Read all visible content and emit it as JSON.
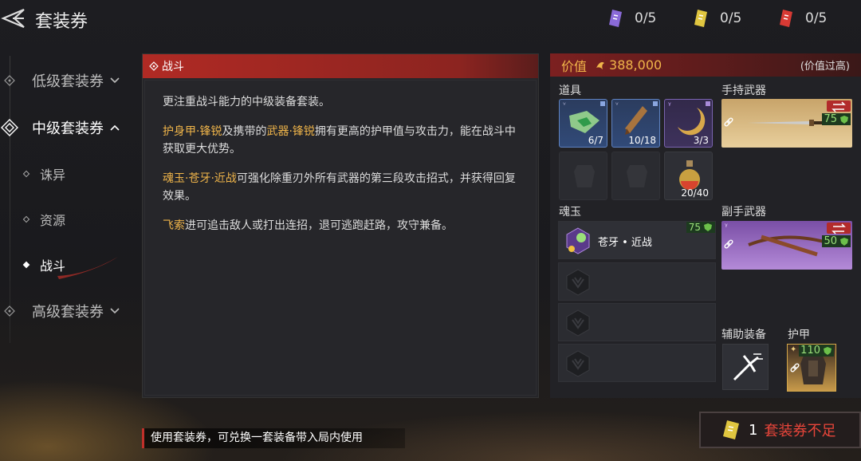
{
  "header": {
    "title": "套装券"
  },
  "currencies": [
    {
      "value": "0/5",
      "color": "#8a6ad8",
      "icon": "ticket-purple-icon"
    },
    {
      "value": "0/5",
      "color": "#e0c640",
      "icon": "ticket-gold-icon"
    },
    {
      "value": "0/5",
      "color": "#d83a34",
      "icon": "ticket-red-icon"
    }
  ],
  "sidebar": {
    "groups": [
      {
        "label": "低级套装券"
      },
      {
        "label": "中级套装券"
      },
      {
        "label": "高级套装券"
      }
    ],
    "subitems": [
      {
        "label": "诛异"
      },
      {
        "label": "资源"
      },
      {
        "label": "战斗"
      }
    ]
  },
  "panel": {
    "title": "战斗",
    "intro": "更注重战斗能力的中级装备套装。",
    "p2_hl1": "护身甲·锋锐",
    "p2_t1": "及携带的",
    "p2_hl2": "武器·锋锐",
    "p2_t2": "拥有更高的护甲值与攻击力，能在战斗中获取更大优势。",
    "p3_hl": "魂玉·苍牙·近战",
    "p3_t": "可强化除重刃外所有武器的第三段攻击招式，并获得回复效果。",
    "p4_hl": "飞索",
    "p4_t": "进可追击敌人或打出连招，退可逃跑赶路，攻守兼备。"
  },
  "right": {
    "value_label": "价值",
    "value": "388,000",
    "value_note": "(价值过高)",
    "items_label": "道具",
    "items": [
      {
        "count": "6/7",
        "rarity": "blue",
        "name": "map-icon"
      },
      {
        "count": "10/18",
        "rarity": "blue",
        "name": "scroll-icon"
      },
      {
        "count": "3/3",
        "rarity": "purple",
        "name": "crescent-icon"
      },
      {
        "count": "",
        "rarity": "empty",
        "name": "empty-slot"
      },
      {
        "count": "",
        "rarity": "empty",
        "name": "empty-slot"
      },
      {
        "count": "20/40",
        "rarity": "empty",
        "name": "flask-icon"
      }
    ],
    "main_weapon_label": "手持武器",
    "main_weapon_level": "75",
    "soul_label": "魂玉",
    "soul": {
      "name": "苍牙 • 近战",
      "level": "75"
    },
    "sub_weapon_label": "副手武器",
    "sub_weapon_level": "50",
    "support_label": "辅助装备",
    "armor_label": "护甲",
    "armor_level": "110"
  },
  "footer": {
    "tip": "使用套装券，可兑换一套装备带入局内使用"
  },
  "exchange": {
    "count": "1",
    "message": "套装券不足"
  }
}
